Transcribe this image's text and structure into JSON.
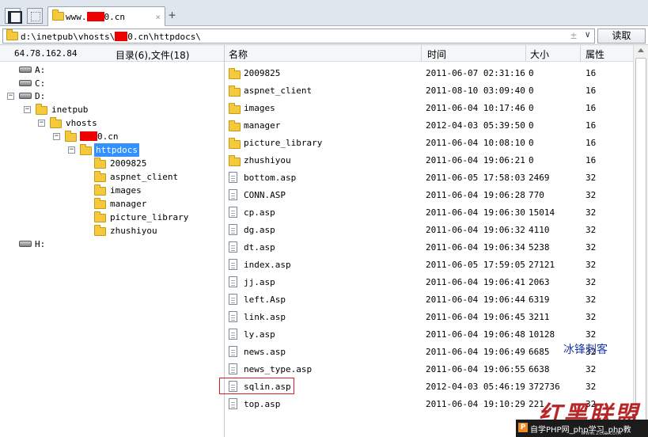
{
  "tab": {
    "title_prefix": "www.",
    "title_suffix": "0.cn",
    "close": "×",
    "add": "+"
  },
  "address": {
    "path_prefix": "d:\\inetpub\\vhosts\\",
    "path_suffix": "0.cn\\httpdocs\\",
    "plus": "±",
    "dropdown": "∨",
    "read_button": "读取"
  },
  "left_panel": {
    "ip": "64.78.162.84",
    "dir_info": "目录(6),文件(18)"
  },
  "tree": {
    "drives": [
      "A:",
      "C:",
      "D:",
      "H:"
    ],
    "inetpub": "inetpub",
    "vhosts": "vhosts",
    "domain_suffix": "0.cn",
    "httpdocs": "httpdocs",
    "subfolders": [
      "2009825",
      "aspnet_client",
      "images",
      "manager",
      "picture_library",
      "zhushiyou"
    ],
    "expand_plus": "+",
    "expand_minus": "−"
  },
  "columns": {
    "name": "名称",
    "time": "时间",
    "size": "大小",
    "attr": "属性"
  },
  "files": [
    {
      "type": "folder",
      "name": "2009825",
      "time": "2011-06-07 02:31:16",
      "size": "0",
      "attr": "16"
    },
    {
      "type": "folder",
      "name": "aspnet_client",
      "time": "2011-08-10 03:09:40",
      "size": "0",
      "attr": "16"
    },
    {
      "type": "folder",
      "name": "images",
      "time": "2011-06-04 10:17:46",
      "size": "0",
      "attr": "16"
    },
    {
      "type": "folder",
      "name": "manager",
      "time": "2012-04-03 05:39:50",
      "size": "0",
      "attr": "16"
    },
    {
      "type": "folder",
      "name": "picture_library",
      "time": "2011-06-04 10:08:10",
      "size": "0",
      "attr": "16"
    },
    {
      "type": "folder",
      "name": "zhushiyou",
      "time": "2011-06-04 19:06:21",
      "size": "0",
      "attr": "16"
    },
    {
      "type": "file",
      "name": "bottom.asp",
      "time": "2011-06-05 17:58:03",
      "size": "2469",
      "attr": "32"
    },
    {
      "type": "file",
      "name": "CONN.ASP",
      "time": "2011-06-04 19:06:28",
      "size": "770",
      "attr": "32"
    },
    {
      "type": "file",
      "name": "cp.asp",
      "time": "2011-06-04 19:06:30",
      "size": "15014",
      "attr": "32"
    },
    {
      "type": "file",
      "name": "dg.asp",
      "time": "2011-06-04 19:06:32",
      "size": "4110",
      "attr": "32"
    },
    {
      "type": "file",
      "name": "dt.asp",
      "time": "2011-06-04 19:06:34",
      "size": "5238",
      "attr": "32"
    },
    {
      "type": "file",
      "name": "index.asp",
      "time": "2011-06-05 17:59:05",
      "size": "27121",
      "attr": "32"
    },
    {
      "type": "file",
      "name": "jj.asp",
      "time": "2011-06-04 19:06:41",
      "size": "2063",
      "attr": "32"
    },
    {
      "type": "file",
      "name": "left.Asp",
      "time": "2011-06-04 19:06:44",
      "size": "6319",
      "attr": "32"
    },
    {
      "type": "file",
      "name": "link.asp",
      "time": "2011-06-04 19:06:45",
      "size": "3211",
      "attr": "32"
    },
    {
      "type": "file",
      "name": "ly.asp",
      "time": "2011-06-04 19:06:48",
      "size": "10128",
      "attr": "32"
    },
    {
      "type": "file",
      "name": "news.asp",
      "time": "2011-06-04 19:06:49",
      "size": "6685",
      "attr": "32"
    },
    {
      "type": "file",
      "name": "news_type.asp",
      "time": "2011-06-04 19:06:55",
      "size": "6638",
      "attr": "32"
    },
    {
      "type": "file",
      "name": "sqlin.asp",
      "time": "2012-04-03 05:46:19",
      "size": "372736",
      "attr": "32"
    },
    {
      "type": "file",
      "name": "top.asp",
      "time": "2011-06-04 19:10:29",
      "size": "221",
      "attr": "32"
    }
  ],
  "overlay": {
    "watermark": "冰锋刺客",
    "logo": "红黑联盟",
    "banner_icon": "P",
    "banner_text": "自学PHP网_php学习_php教",
    "banner_url": "www.2cto.com"
  }
}
